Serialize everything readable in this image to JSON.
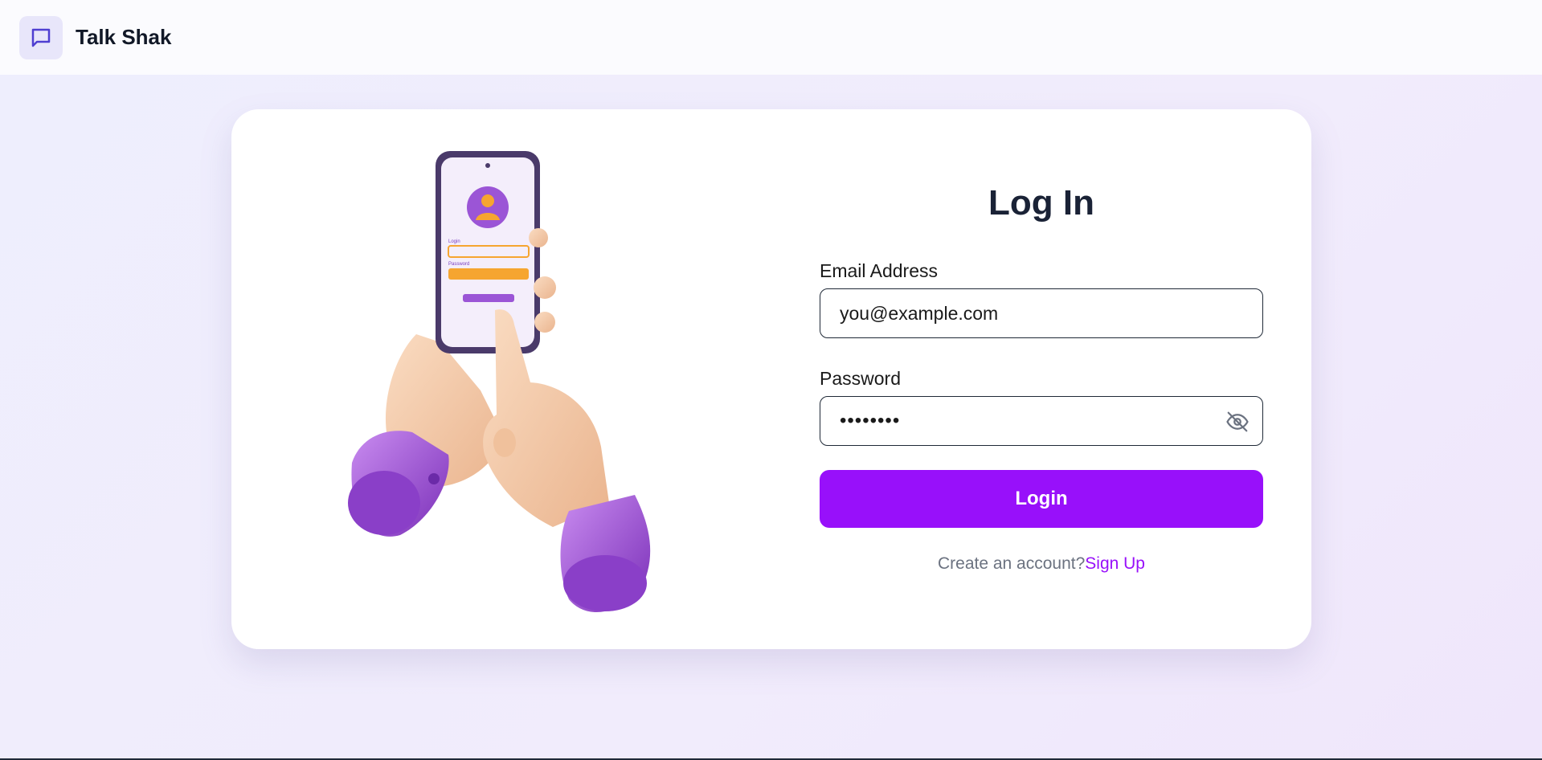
{
  "header": {
    "brand": "Talk Shak",
    "logo_icon": "chat-bubble-icon"
  },
  "login": {
    "title": "Log In",
    "email_label": "Email Address",
    "email_value": "you@example.com",
    "password_label": "Password",
    "password_value": "••••••••",
    "password_toggle_icon": "eye-off-icon",
    "submit_label": "Login",
    "signup_prompt": "Create an account?",
    "signup_link": "Sign Up"
  },
  "illustration": {
    "phone_login_label": "Login",
    "phone_password_label": "Password"
  },
  "colors": {
    "accent": "#9810fa",
    "title": "#1a2236",
    "cuff": "#9b4fd6",
    "skin": "#f6cfae",
    "orange": "#f6a530"
  }
}
